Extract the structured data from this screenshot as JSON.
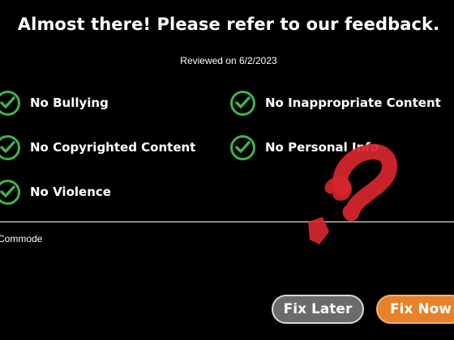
{
  "dialog": {
    "title": "Almost there! Please refer to our feedback.",
    "reviewed": "Reviewed on 6/2/2023",
    "author": "Commode"
  },
  "checklist": [
    {
      "label": "No Bullying",
      "status": "passed"
    },
    {
      "label": "No Inappropriate Content",
      "status": "passed"
    },
    {
      "label": "No Copyrighted Content",
      "status": "passed"
    },
    {
      "label": "No Personal Info",
      "status": "passed"
    },
    {
      "label": "No Violence",
      "status": "passed"
    }
  ],
  "buttons": {
    "fix_later": "Fix Later",
    "fix_now": "Fix Now"
  },
  "icons": {
    "check": "check-circle-icon",
    "question_mark": "question-mark-icon"
  },
  "colors": {
    "background": "#000000",
    "check_green": "#3fb24f",
    "question_red": "#d9262e",
    "fix_now_orange": "#e8822a",
    "fix_later_gray": "#6b6b6b"
  }
}
